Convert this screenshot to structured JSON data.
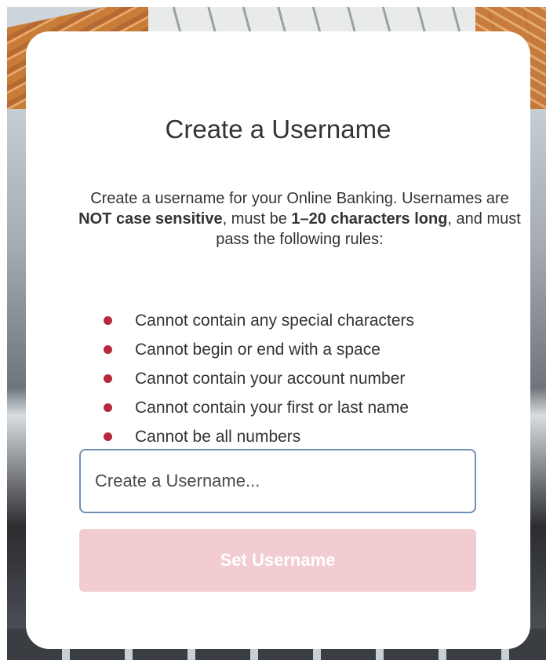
{
  "modal": {
    "title": "Create a Username",
    "intro": {
      "part1": "Create a username for your Online Banking. Usernames are ",
      "bold1": "NOT case sensitive",
      "part2": ", must be ",
      "bold2": "1–20 characters long",
      "part3": ", and must pass the following rules:"
    },
    "rules": [
      "Cannot contain any special characters",
      "Cannot begin or end with a space",
      "Cannot contain your account number",
      "Cannot contain your first or last name",
      "Cannot be all numbers"
    ],
    "username_input": {
      "placeholder": "Create a Username...",
      "value": ""
    },
    "submit_label": "Set Username"
  },
  "colors": {
    "bullet": "#b7283b",
    "button_disabled_bg": "#f2ccd1",
    "input_border": "#6f8fb6"
  }
}
